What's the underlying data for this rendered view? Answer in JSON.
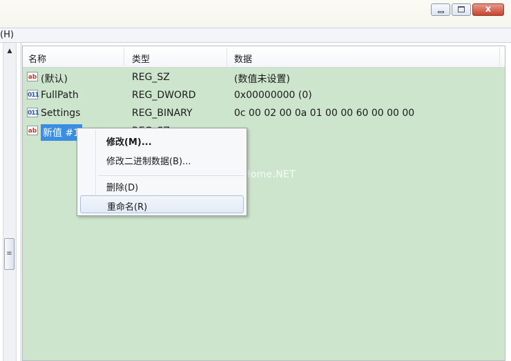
{
  "window": {
    "minimize_icon": "minimize-icon",
    "maximize_icon": "maximize-icon",
    "close_label": "x"
  },
  "menubar": {
    "help_label": "(H)"
  },
  "columns": {
    "name": "名称",
    "type": "类型",
    "data": "数据"
  },
  "rows": [
    {
      "icon": "ab",
      "name": "(默认)",
      "type": "REG_SZ",
      "data": "(数值未设置)"
    },
    {
      "icon": "binary",
      "name": "FullPath",
      "type": "REG_DWORD",
      "data": "0x00000000 (0)"
    },
    {
      "icon": "binary",
      "name": "Settings",
      "type": "REG_BINARY",
      "data": "0c 00 02 00 0a 01 00 00 60 00 00 00"
    },
    {
      "icon": "ab",
      "name": "新值 #1",
      "type": "REG_SZ",
      "data": ""
    }
  ],
  "context_menu": {
    "modify": "修改(M)...",
    "modify_binary": "修改二进制数据(B)...",
    "delete": "删除(D)",
    "rename": "重命名(R)"
  },
  "watermark": "www.pHome.NET",
  "colors": {
    "pane_bg": "#cde5cc",
    "selection": "#3a8de0",
    "close_button": "#c8442e"
  }
}
